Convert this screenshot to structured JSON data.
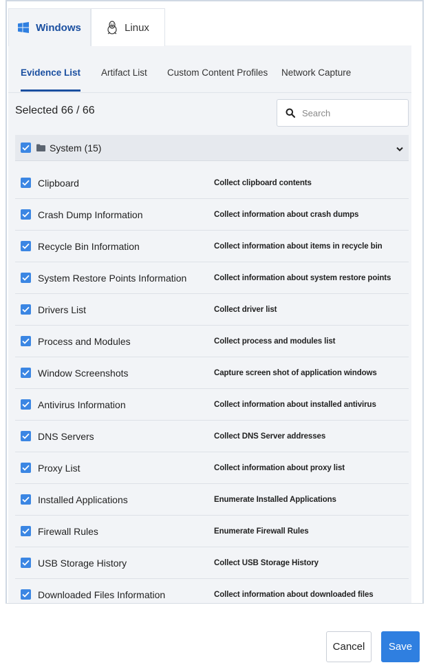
{
  "os_tabs": [
    {
      "label": "Windows",
      "icon": "windows-icon",
      "active": true
    },
    {
      "label": "Linux",
      "icon": "linux-penguin-icon",
      "active": false
    }
  ],
  "sub_tabs": [
    {
      "label": "Evidence List",
      "active": true
    },
    {
      "label": "Artifact List",
      "active": false
    },
    {
      "label": "Custom Content Profiles",
      "active": false
    },
    {
      "label": "Network Capture",
      "active": false
    }
  ],
  "selection": {
    "count_text": "Selected 66 / 66"
  },
  "search": {
    "placeholder": "Search",
    "value": ""
  },
  "group": {
    "label": "System (15)",
    "checked": true
  },
  "items": [
    {
      "name": "Clipboard",
      "description": "Collect clipboard contents",
      "checked": true
    },
    {
      "name": "Crash Dump Information",
      "description": "Collect information about crash dumps",
      "checked": true
    },
    {
      "name": "Recycle Bin Information",
      "description": "Collect information about items in recycle bin",
      "checked": true
    },
    {
      "name": "System Restore Points Information",
      "description": "Collect information about system restore points",
      "checked": true
    },
    {
      "name": "Drivers List",
      "description": "Collect driver list",
      "checked": true
    },
    {
      "name": "Process and Modules",
      "description": "Collect process and modules list",
      "checked": true
    },
    {
      "name": "Window Screenshots",
      "description": "Capture screen shot of application windows",
      "checked": true
    },
    {
      "name": "Antivirus Information",
      "description": "Collect information about installed antivirus",
      "checked": true
    },
    {
      "name": "DNS Servers",
      "description": "Collect DNS Server addresses",
      "checked": true
    },
    {
      "name": "Proxy List",
      "description": "Collect information about proxy list",
      "checked": true
    },
    {
      "name": "Installed Applications",
      "description": "Enumerate Installed Applications",
      "checked": true
    },
    {
      "name": "Firewall Rules",
      "description": "Enumerate Firewall Rules",
      "checked": true
    },
    {
      "name": "USB Storage History",
      "description": "Collect USB Storage History",
      "checked": true
    },
    {
      "name": "Downloaded Files Information",
      "description": "Collect information about downloaded files",
      "checked": true
    }
  ],
  "footer": {
    "cancel_label": "Cancel",
    "save_label": "Save"
  },
  "colors": {
    "accent": "#1a4fa0",
    "checkbox": "#3b86e3",
    "save_button": "#2f7fe0",
    "panel_bg": "#f2f4f7"
  }
}
